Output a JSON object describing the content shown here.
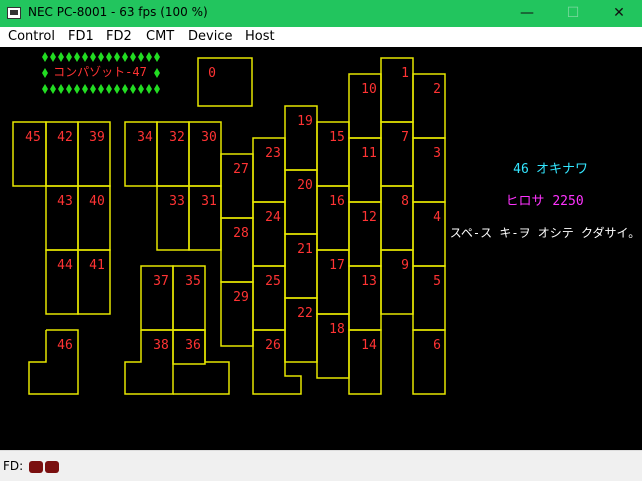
{
  "window": {
    "title": "NEC PC-8001 - 63 fps (100 %)",
    "min_glyph": "—",
    "max_glyph": "☐",
    "close_glyph": "✕"
  },
  "menu": [
    "Control",
    "FD1",
    "FD2",
    "CMT",
    "Device",
    "Host"
  ],
  "game": {
    "title": "コンパゾット-47",
    "pref_number": "46",
    "pref_name": "オキナワ",
    "player_name": "ヒロサ",
    "score": "2250",
    "instruction": "スペ-ス キ-ヲ オシテ クダサイ。",
    "cells": [
      "0",
      "1",
      "2",
      "3",
      "4",
      "5",
      "6",
      "7",
      "8",
      "9",
      "10",
      "11",
      "12",
      "13",
      "14",
      "15",
      "16",
      "17",
      "18",
      "19",
      "20",
      "21",
      "22",
      "23",
      "24",
      "25",
      "26",
      "27",
      "28",
      "29",
      "30",
      "31",
      "32",
      "33",
      "34",
      "35",
      "36",
      "37",
      "38",
      "39",
      "40",
      "41",
      "42",
      "43",
      "44",
      "45",
      "46"
    ]
  },
  "status": {
    "fd_label": "FD:"
  },
  "colors": {
    "titlebar": "#22c55e",
    "map_line": "#e6e600",
    "cell_text": "#ff3333",
    "cyan": "#33e6ff",
    "magenta": "#ff33ff",
    "diamond": "#22dd22",
    "led": "#7a0f0f"
  }
}
